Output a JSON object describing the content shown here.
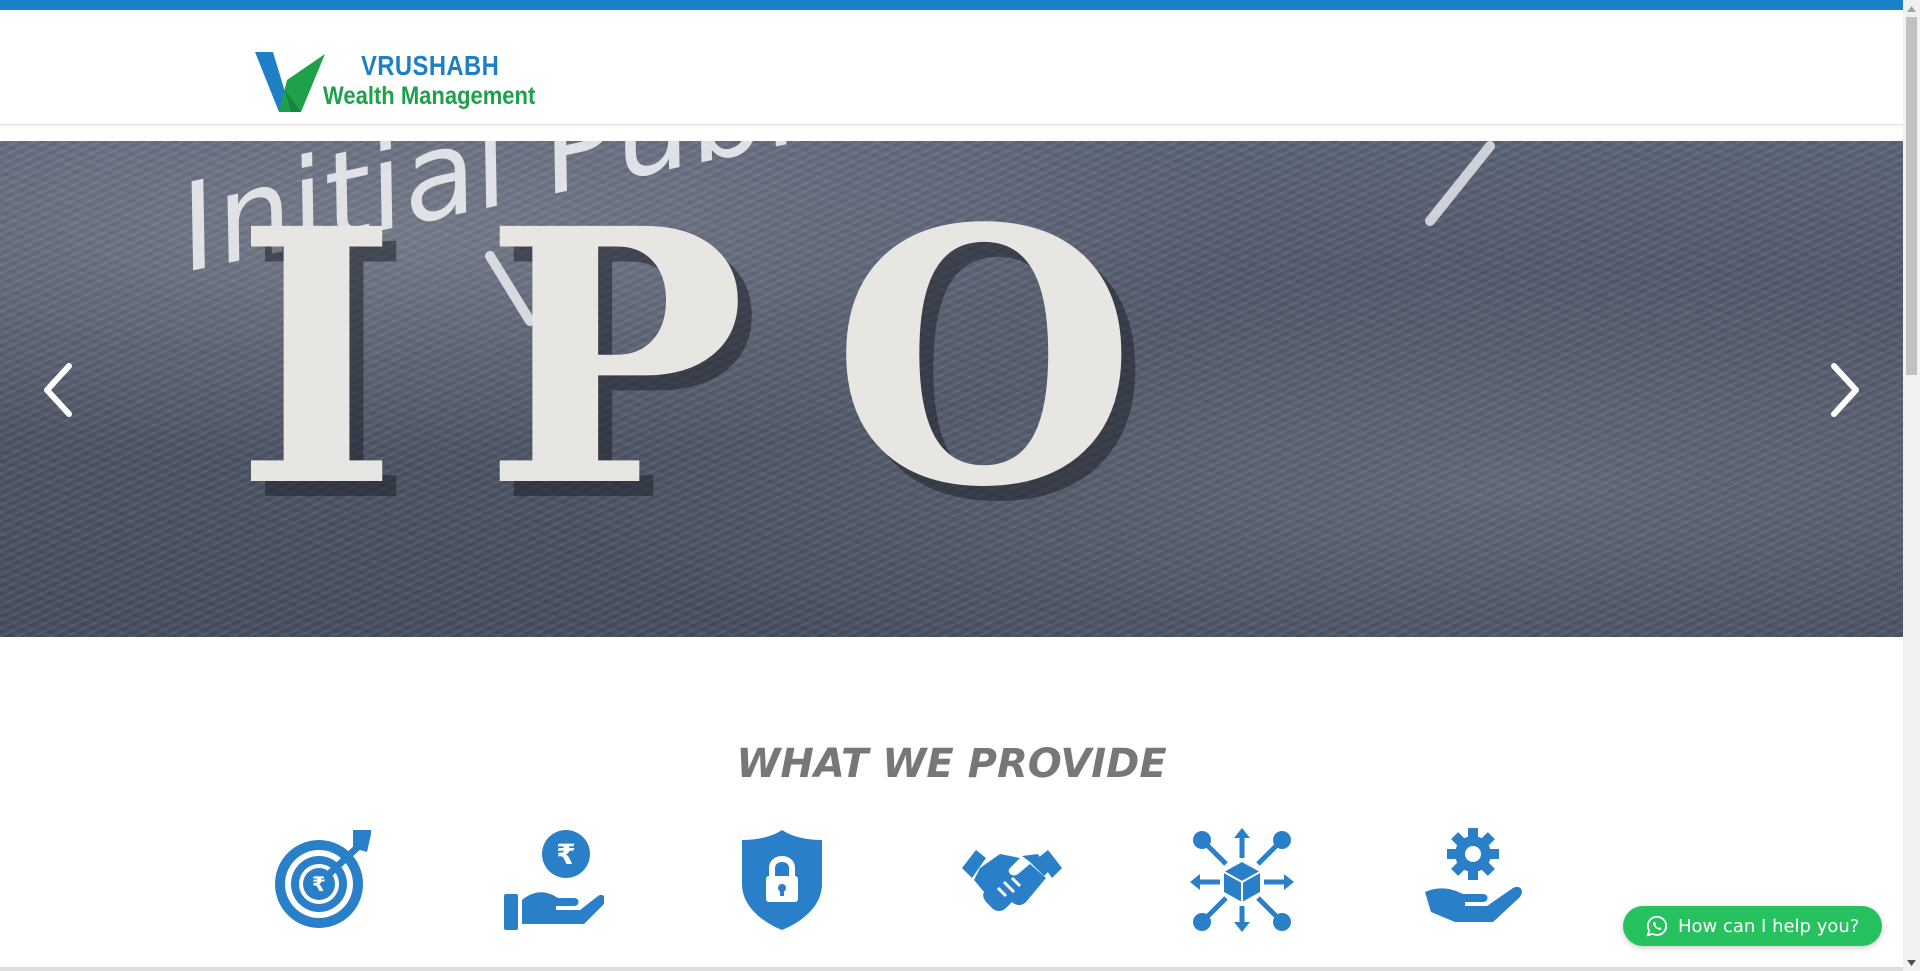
{
  "brand": {
    "name_line1": "VRUSHABH",
    "name_line2": "Wealth Management",
    "colors": {
      "blue": "#1f7fc4",
      "green": "#1fa04a"
    }
  },
  "hero": {
    "slide_script_text": "Initial Public Offer",
    "slide_big_text": "IPO",
    "prev_icon": "chevron-left-icon",
    "next_icon": "chevron-right-icon"
  },
  "section": {
    "title": "WHAT WE PROVIDE"
  },
  "services": [
    {
      "icon": "rupee-target-icon"
    },
    {
      "icon": "rupee-hand-icon"
    },
    {
      "icon": "lock-shield-icon"
    },
    {
      "icon": "handshake-icon"
    },
    {
      "icon": "network-cube-icon"
    },
    {
      "icon": "gear-hand-icon"
    }
  ],
  "whatsapp": {
    "label": "How can I help you?",
    "icon": "whatsapp-icon",
    "color": "#25c25f"
  },
  "accent": "#2a7fc9"
}
